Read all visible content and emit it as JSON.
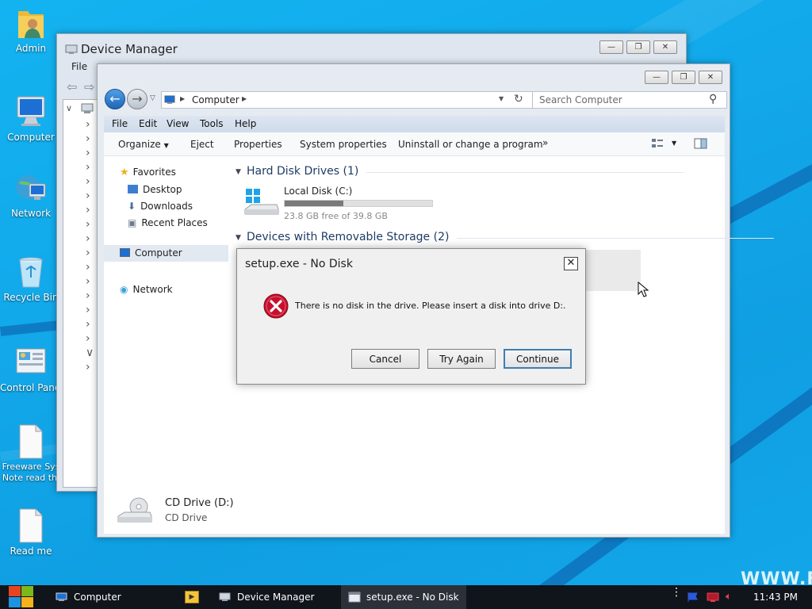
{
  "desktop_icons": [
    {
      "label": "Admin",
      "icon": "user-folder-icon"
    },
    {
      "label": "Computer",
      "icon": "computer-icon"
    },
    {
      "label": "Network",
      "icon": "network-icon"
    },
    {
      "label": "Recycle Bin",
      "icon": "recycle-bin-icon"
    },
    {
      "label": "Control Panel",
      "icon": "control-panel-icon"
    },
    {
      "label": "Freeware Sys Note read thi",
      "icon": "document-icon"
    },
    {
      "label": "Read me",
      "icon": "document-icon"
    }
  ],
  "device_manager": {
    "title": "Device Manager",
    "menu": [
      "File"
    ]
  },
  "explorer": {
    "breadcrumb": "Computer",
    "search_placeholder": "Search Computer",
    "menu": [
      "File",
      "Edit",
      "View",
      "Tools",
      "Help"
    ],
    "toolbar": [
      "Organize",
      "Eject",
      "Properties",
      "System properties",
      "Uninstall or change a program"
    ],
    "nav": {
      "favorites": "Favorites",
      "favorite_items": [
        "Desktop",
        "Downloads",
        "Recent Places"
      ],
      "computer": "Computer",
      "network": "Network"
    },
    "hard_disk_group": "Hard Disk Drives (1)",
    "local_disk": {
      "name": "Local Disk (C:)",
      "free_text": "23.8 GB free of 39.8 GB",
      "used_fraction": 0.4
    },
    "removable_group": "Devices with Removable Storage (2)",
    "details": {
      "name": "CD Drive (D:)",
      "type": "CD Drive"
    }
  },
  "dialog": {
    "title": "setup.exe - No Disk",
    "message": "There is no disk in the drive. Please insert a disk into drive D:.",
    "buttons": {
      "cancel": "Cancel",
      "try_again": "Try Again",
      "continue": "Continue"
    }
  },
  "taskbar": {
    "items": [
      "Computer",
      "Device Manager",
      "setup.exe - No Disk"
    ],
    "clock": "11:43 PM"
  },
  "watermark": "WWW.FR",
  "colors": {
    "accent": "#1aa6e6",
    "error": "#c8102e",
    "taskbar": "#10141b",
    "selection": "#e5f0fb"
  }
}
